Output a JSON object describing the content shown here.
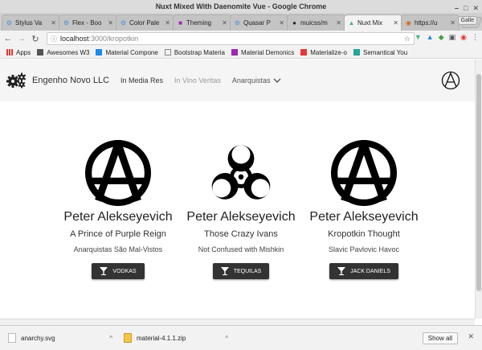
{
  "window": {
    "title": "Nuxt Mixed With Daenomite Vue - Google Chrome"
  },
  "tabs": [
    {
      "label": "Stylus Va",
      "fav": "⚙",
      "color": "#4a90d9"
    },
    {
      "label": "Flex - Boo",
      "fav": "⚙",
      "color": "#4a90d9"
    },
    {
      "label": "Color Pale",
      "fav": "⚙",
      "color": "#4a90d9"
    },
    {
      "label": "Theming",
      "fav": "■",
      "color": "#9c27b0"
    },
    {
      "label": "Quasar P",
      "fav": "⚙",
      "color": "#4a90d9"
    },
    {
      "label": "muicss/m",
      "fav": "●",
      "color": "#222222"
    },
    {
      "label": "Nuxt Mix",
      "fav": "▲",
      "color": "#41b883",
      "active": true
    },
    {
      "label": "https://u",
      "fav": "◉",
      "color": "#d2691e"
    }
  ],
  "profile_label": "Galle",
  "address": {
    "host": "localhost",
    "path": ":3000/kropotkin"
  },
  "bookmarks": [
    {
      "label": "Apps",
      "color": "#e53935"
    },
    {
      "label": "Awesomes W3",
      "color": "#555555"
    },
    {
      "label": "Material Compone",
      "color": "#1e88e5"
    },
    {
      "label": "Bootstrap Materia",
      "color": "#888888"
    },
    {
      "label": "Material Demonics",
      "color": "#9c27b0"
    },
    {
      "label": "Materialize-o",
      "color": "#e53935"
    },
    {
      "label": "Semantical You",
      "color": "#26a69a"
    }
  ],
  "appbar": {
    "brand": "Engenho Novo LLC",
    "nav": [
      "In Media Res",
      "In Vino Veritas",
      "Anarquistas"
    ]
  },
  "cards": [
    {
      "icon": "anarchy",
      "title": "Peter Alekseyevich",
      "subtitle": "A Prince of Purple Reign",
      "desc": "Anarquistas São Mal-Vistos",
      "button": "VODKAS"
    },
    {
      "icon": "biohazard",
      "title": "Peter Alekseyevich",
      "subtitle": "Those Crazy Ivans",
      "desc": "Not Confused with Mishkin",
      "button": "TEQUILAS"
    },
    {
      "icon": "anarchy",
      "title": "Peter Alekseyevich",
      "subtitle": "Kropotkin Thought",
      "desc": "Slavic Pavlovic Havoc",
      "button": "JACK DANIELS"
    }
  ],
  "downloads": [
    {
      "name": "anarchy.svg"
    },
    {
      "name": "material-4.1.1.zip"
    }
  ],
  "show_all": "Show all"
}
